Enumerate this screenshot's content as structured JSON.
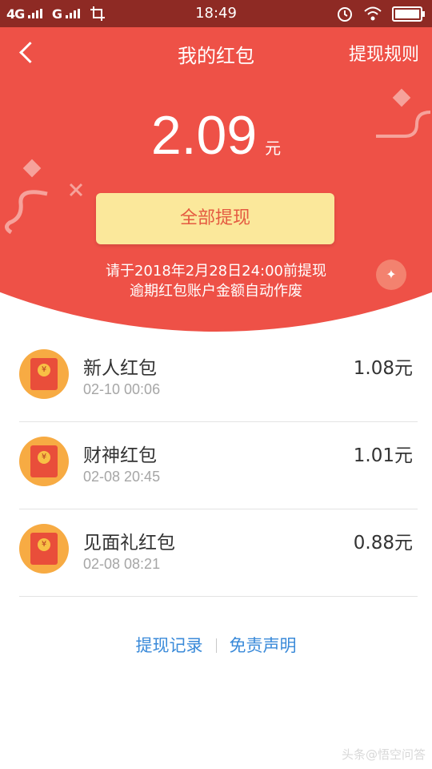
{
  "status_bar": {
    "sim1": "4G",
    "sim2": "G",
    "time": "18:49"
  },
  "header": {
    "title": "我的红包",
    "rules_link": "提现规则"
  },
  "balance": {
    "amount": "2.09",
    "unit": "元"
  },
  "withdraw_all_label": "全部提现",
  "notice": {
    "line1": "请于2018年2月28日24:00前提现",
    "line2": "逾期红包账户金额自动作废"
  },
  "packets": [
    {
      "name": "新人红包",
      "time": "02-10 00:06",
      "amount": "1.08元"
    },
    {
      "name": "财神红包",
      "time": "02-08 20:45",
      "amount": "1.01元"
    },
    {
      "name": "见面礼红包",
      "time": "02-08 08:21",
      "amount": "0.88元"
    }
  ],
  "footer_links": {
    "records": "提现记录",
    "disclaimer": "免责声明"
  },
  "watermark": "头条@悟空问答",
  "icons": {
    "back": "chevron-left-icon",
    "packet": "red-envelope-icon",
    "alarm": "alarm-icon",
    "wifi": "wifi-icon",
    "battery": "battery-icon"
  },
  "colors": {
    "hero_red": "#ee5147",
    "button_yellow": "#fbe89b",
    "link_blue": "#3a8ad9",
    "packet_orange": "#f7ab43"
  }
}
